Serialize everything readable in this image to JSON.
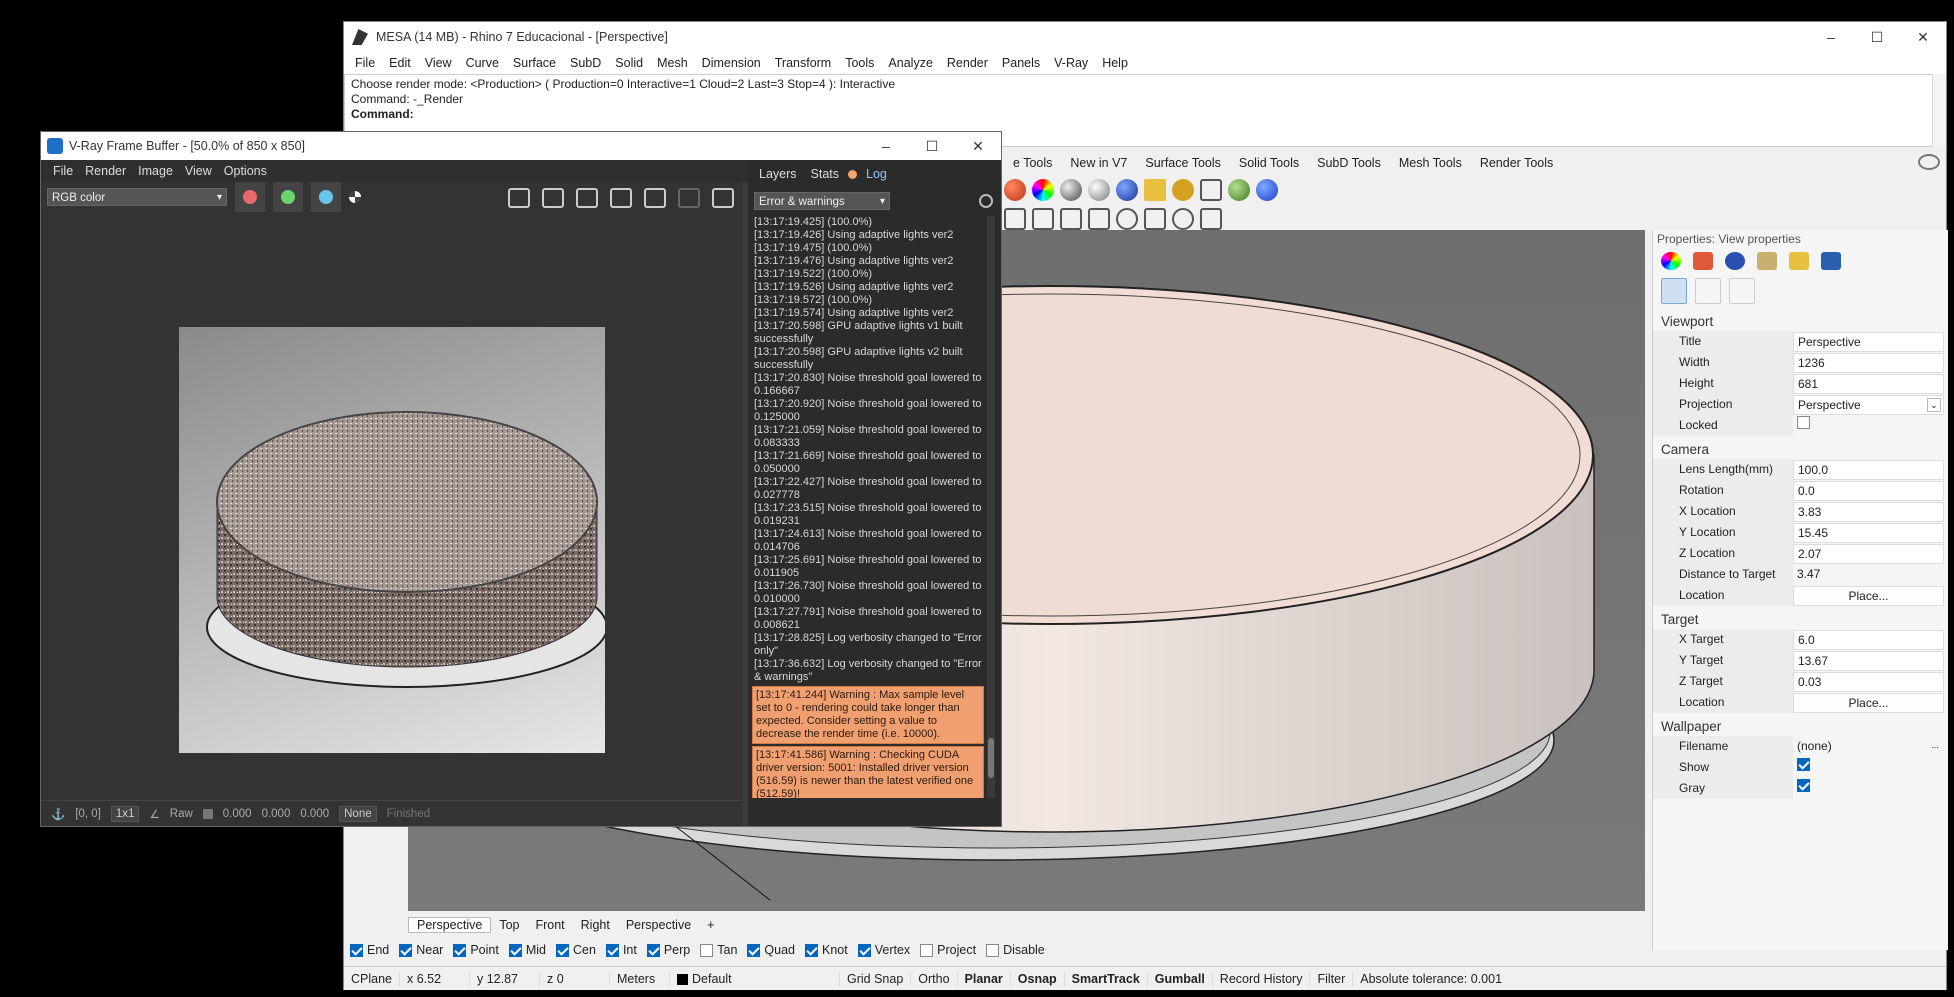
{
  "rhino": {
    "title": "MESA (14 MB) - Rhino 7 Educacional - [Perspective]",
    "menu": [
      "File",
      "Edit",
      "View",
      "Curve",
      "Surface",
      "SubD",
      "Solid",
      "Mesh",
      "Dimension",
      "Transform",
      "Tools",
      "Analyze",
      "Render",
      "Panels",
      "V-Ray",
      "Help"
    ],
    "command_history": [
      "Choose render mode: <Production> ( Production=0  Interactive=1  Cloud=2  Last=3  Stop=4 ): Interactive",
      "Command: -_Render"
    ],
    "command_prompt": "Command:",
    "toolbar_tabs": [
      "e Tools",
      "New in V7",
      "Surface Tools",
      "Solid Tools",
      "SubD Tools",
      "Mesh Tools",
      "Render Tools"
    ],
    "viewport_tabs": [
      "Perspective",
      "Top",
      "Front",
      "Right",
      "Perspective"
    ],
    "viewport_add": "+",
    "osnaps": [
      {
        "label": "End",
        "on": true
      },
      {
        "label": "Near",
        "on": true
      },
      {
        "label": "Point",
        "on": true
      },
      {
        "label": "Mid",
        "on": true
      },
      {
        "label": "Cen",
        "on": true
      },
      {
        "label": "Int",
        "on": true
      },
      {
        "label": "Perp",
        "on": true
      },
      {
        "label": "Tan",
        "on": false
      },
      {
        "label": "Quad",
        "on": true
      },
      {
        "label": "Knot",
        "on": true
      },
      {
        "label": "Vertex",
        "on": true
      },
      {
        "label": "Project",
        "on": false
      },
      {
        "label": "Disable",
        "on": false
      }
    ],
    "status": {
      "cplane": "CPlane",
      "x": "x 6.52",
      "y": "y 12.87",
      "z": "z 0",
      "units": "Meters",
      "layer": "Default",
      "grid_snap": "Grid Snap",
      "ortho": "Ortho",
      "planar": "Planar",
      "osnap": "Osnap",
      "smarttrack": "SmartTrack",
      "gumball": "Gumball",
      "record_history": "Record History",
      "filter": "Filter",
      "tolerance": "Absolute tolerance: 0.001"
    },
    "properties": {
      "title": "Properties: View properties",
      "sections": {
        "viewport": "Viewport",
        "camera": "Camera",
        "target": "Target",
        "wallpaper": "Wallpaper"
      },
      "viewport": [
        {
          "k": "Title",
          "v": "Perspective"
        },
        {
          "k": "Width",
          "v": "1236"
        },
        {
          "k": "Height",
          "v": "681"
        },
        {
          "k": "Projection",
          "v": "Perspective"
        },
        {
          "k": "Locked",
          "v": ""
        }
      ],
      "camera": [
        {
          "k": "Lens Length(mm)",
          "v": "100.0"
        },
        {
          "k": "Rotation",
          "v": "0.0"
        },
        {
          "k": "X Location",
          "v": "3.83"
        },
        {
          "k": "Y Location",
          "v": "15.45"
        },
        {
          "k": "Z Location",
          "v": "2.07"
        },
        {
          "k": "Distance to Target",
          "v": "3.47"
        },
        {
          "k": "Location",
          "v": "Place..."
        }
      ],
      "target": [
        {
          "k": "X Target",
          "v": "6.0"
        },
        {
          "k": "Y Target",
          "v": "13.67"
        },
        {
          "k": "Z Target",
          "v": "0.03"
        },
        {
          "k": "Location",
          "v": "Place..."
        }
      ],
      "wallpaper": [
        {
          "k": "Filename",
          "v": "(none)"
        },
        {
          "k": "Show",
          "v": ""
        },
        {
          "k": "Gray",
          "v": ""
        }
      ],
      "filename_browse": "...",
      "locked": false,
      "show": true,
      "gray": true
    }
  },
  "vfb": {
    "title": "V-Ray Frame Buffer - [50.0% of 850 x 850]",
    "menu": [
      "File",
      "Render",
      "Image",
      "View",
      "Options"
    ],
    "channel": "RGB color",
    "bottom": {
      "coords": "[0, 0]",
      "zoom": "1x1",
      "raw": "Raw",
      "r": "0.000",
      "g": "0.000",
      "b": "0.000",
      "mode": "None",
      "state": "Finished"
    },
    "tabs": [
      "Layers",
      "Stats",
      "Log"
    ],
    "log_filter": "Error & warnings",
    "log": [
      "[13:17:19.425]  (100.0%)",
      "[13:17:19.426] Using adaptive lights ver2",
      "[13:17:19.475]  (100.0%)",
      "[13:17:19.476] Using adaptive lights ver2",
      "[13:17:19.522]  (100.0%)",
      "[13:17:19.526] Using adaptive lights ver2",
      "[13:17:19.572]  (100.0%)",
      "[13:17:19.574] Using adaptive lights ver2",
      "[13:17:20.598] GPU adaptive lights v1 built successfully",
      "[13:17:20.598] GPU adaptive lights v2 built successfully",
      "[13:17:20.830] Noise threshold goal lowered to 0.166667",
      "[13:17:20.920] Noise threshold goal lowered to 0.125000",
      "[13:17:21.059] Noise threshold goal lowered to 0.083333",
      "[13:17:21.669] Noise threshold goal lowered to 0.050000",
      "[13:17:22.427] Noise threshold goal lowered to 0.027778",
      "[13:17:23.515] Noise threshold goal lowered to 0.019231",
      "[13:17:24.613] Noise threshold goal lowered to 0.014706",
      "[13:17:25.691] Noise threshold goal lowered to 0.011905",
      "[13:17:26.730] Noise threshold goal lowered to 0.010000",
      "[13:17:27.791] Noise threshold goal lowered to 0.008621",
      "[13:17:28.825] Log verbosity changed to \"Error only\"",
      "[13:17:36.632] Log verbosity changed to \"Error & warnings\""
    ],
    "warnings": [
      "[13:17:41.244] Warning : Max sample level set to 0 - rendering could take longer than expected. Consider setting a value to decrease the render time (i.e. 10000).",
      "[13:17:41.586] Warning : Checking CUDA driver version: 5001: Installed driver version (516.59) is newer than the latest verified one (512.59)!"
    ]
  },
  "colors": {
    "accent": "#0067c0",
    "warning_bg": "#f0a070",
    "log_active_tab": "#8fc4ff",
    "channel_red": "#e86a6a",
    "channel_green": "#6ad46a",
    "channel_blue": "#6ac4f0"
  }
}
